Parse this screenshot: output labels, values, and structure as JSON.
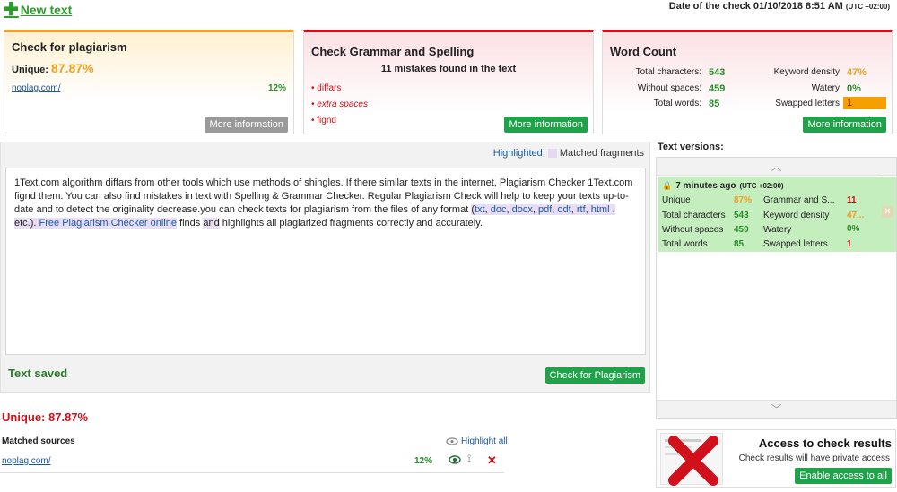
{
  "header": {
    "new_text_label": "New text",
    "date_label": "Date of the check 01/10/2018 8:51 AM",
    "date_utc": "(UTC +02:00)"
  },
  "plagiarism_card": {
    "title": "Check for plagiarism",
    "unique_label": "Unique:",
    "unique_value": "87.87%",
    "source_link": "noplag.com/",
    "source_pct": "12%",
    "more_info": "More information"
  },
  "grammar_card": {
    "title": "Check Grammar and Spelling",
    "summary": "11 mistakes found in the text",
    "mistakes": [
      "diffars",
      "extra spaces",
      "fignd"
    ],
    "more_info": "More information"
  },
  "word_card": {
    "title": "Word Count",
    "total_chars_label": "Total characters:",
    "total_chars": "543",
    "without_spaces_label": "Without spaces:",
    "without_spaces": "459",
    "total_words_label": "Total words:",
    "total_words": "85",
    "keyword_density_label": "Keyword density",
    "keyword_density": "47%",
    "watery_label": "Watery",
    "watery": "0%",
    "swapped_label": "Swapped letters",
    "swapped": "1",
    "more_info": "More information"
  },
  "editor": {
    "highlighted_label": "Highlighted:",
    "matched_fragments_label": "Matched fragments",
    "text_saved": "Text saved",
    "check_button": "Check for Plagiarism",
    "text": {
      "p1": "1Text.com algorithm diffars from other tools which use methods of shingles. If there  similar texts in the internet, Plagiarism Checker 1Text.com fignd them. You can also find mistakes in text with Spelling & Grammar Checker. Regular Plagiarism Check will help to keep your texts up-to-date and to detect the originality decrease.you can check texts for plagiarism from the files of any format ",
      "m_paren_open": "(",
      "m_txt": "txt",
      "m_c1": ", ",
      "m_doc": "doc",
      "m_c2": ", ",
      "m_docx": "docx",
      "m_c3": ", ",
      "m_pdf": "pdf",
      "m_c4": ", ",
      "m_odt": "odt",
      "m_c5": ", ",
      "m_rtf": "rtf",
      "m_c6": ", ",
      "m_html": "html",
      "m_tail": " , etc.). ",
      "m_free": "Free Plagiarism Checker online",
      "p2a": " finds ",
      "m_and": "and",
      "p2b": " highlights all plagiarized fragments correctly and accurately."
    }
  },
  "versions": {
    "title": "Text versions:",
    "item": {
      "time": "7 minutes ago",
      "utc": "(UTC +02:00)",
      "unique_label": "Unique",
      "unique": "87%",
      "grammar_label": "Grammar and S...",
      "grammar": "11",
      "total_chars_label": "Total characters",
      "total_chars": "543",
      "keyword_label": "Keyword density",
      "keyword": "47...",
      "without_spaces_label": "Without spaces",
      "without_spaces": "459",
      "watery_label": "Watery",
      "watery": "0%",
      "total_words_label": "Total words",
      "total_words": "85",
      "swapped_label": "Swapped letters",
      "swapped": "1"
    }
  },
  "results": {
    "unique_text": "Unique: 87.87%",
    "matched_sources_label": "Matched sources",
    "highlight_all": "Highlight all",
    "source_link": "noplag.com/",
    "source_pct": "12%"
  },
  "access": {
    "title": "Access to check results",
    "subtitle": "Check results will have private access",
    "button": "Enable access to all"
  },
  "colors": {
    "brand_green": "#1fa24a",
    "alert_red": "#d0101a",
    "accent_orange": "#f0a030",
    "match_highlight": "#e8ddf4"
  }
}
